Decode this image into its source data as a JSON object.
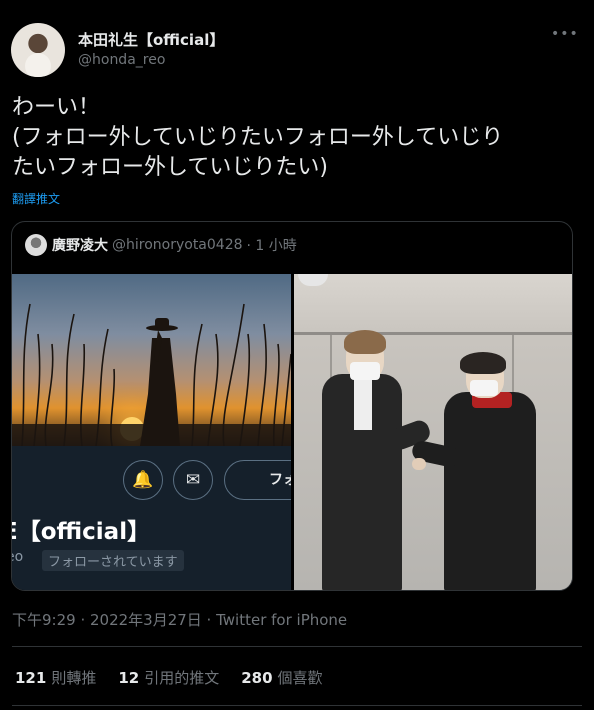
{
  "author": {
    "display_name": "本田礼生【official】",
    "handle": "@honda_reo"
  },
  "more_icon": "more-dots-icon",
  "tweet_lines": [
    "わーい！",
    "(フォロー外していじりたいフォロー外していじり",
    "たいフォロー外していじりたい)"
  ],
  "translate_label": "翻譯推文",
  "quote": {
    "display_name": "廣野凌大",
    "handle": "@hironoryota0428",
    "time": "· 1 小時",
    "screenshot": {
      "bell_icon": "bell-plus-icon",
      "mail_icon": "mail-icon",
      "follow_label": "フォ",
      "name_fragment": "E【official】",
      "handle_fragment": "eo",
      "follows_you": "フォローされています"
    }
  },
  "timestamp": "下午9:29 · 2022年3月27日 · Twitter for iPhone",
  "stats": [
    {
      "count": "121",
      "label": "則轉推"
    },
    {
      "count": "12",
      "label": "引用的推文"
    },
    {
      "count": "280",
      "label": "個喜歡"
    }
  ],
  "colors": {
    "background": "#000000",
    "text": "#e7e9ea",
    "muted": "#71767b",
    "link": "#1d9bf0",
    "border": "#2f3336"
  }
}
